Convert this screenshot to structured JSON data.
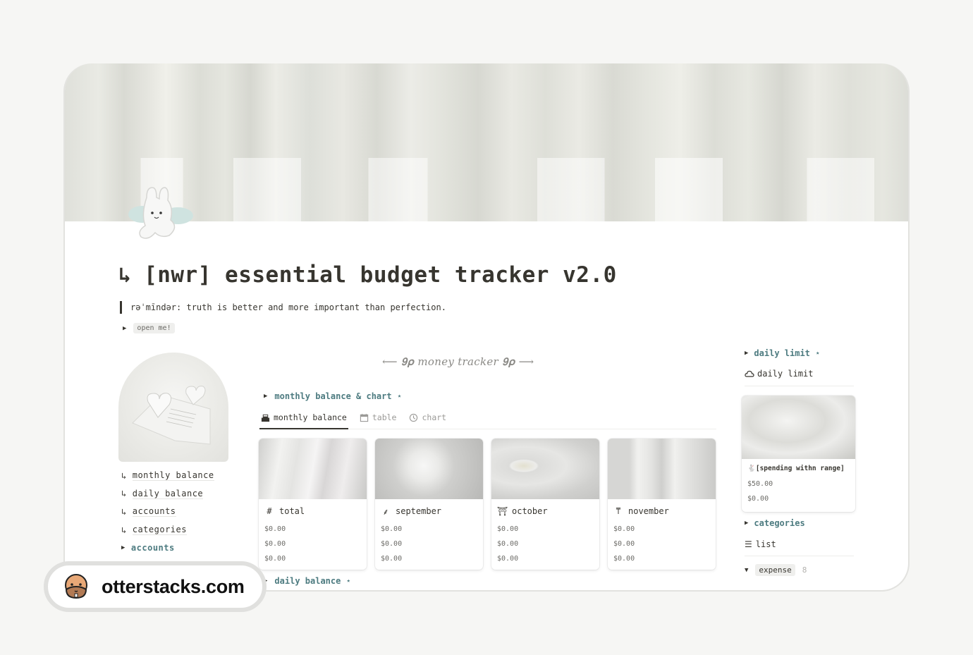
{
  "page": {
    "title_prefix_icon": "return-arrow-icon",
    "title": "[nwr] essential budget tracker v2.0",
    "quote": "rəˈmīndər: truth is better and more important than perfection.",
    "open_toggle": {
      "label": "open me!"
    }
  },
  "left_nav": {
    "links": [
      {
        "arrow": "↳",
        "label": "monthly balance"
      },
      {
        "arrow": "↳",
        "label": "daily balance"
      },
      {
        "arrow": "↳",
        "label": "accounts"
      },
      {
        "arrow": "↳",
        "label": "categories"
      }
    ],
    "accounts_toggle": {
      "label": "accounts"
    }
  },
  "main": {
    "banner": "⟵ 𝟗𝛒 money tracker 𝟗𝛒 ⟶",
    "monthly_section": {
      "label": "monthly balance & chart ⋆"
    },
    "tabs": [
      {
        "label": "monthly balance",
        "icon": "cash-register-icon",
        "active": true
      },
      {
        "label": "table",
        "icon": "calendar-icon",
        "active": false
      },
      {
        "label": "chart",
        "icon": "clock-chart-icon",
        "active": false
      }
    ],
    "cards": [
      {
        "title": "total",
        "icon": "#",
        "icon_name": "hash-icon",
        "values": [
          "$0.00",
          "$0.00",
          "$0.00"
        ]
      },
      {
        "title": "september",
        "icon": "⸙",
        "icon_name": "leaf-icon",
        "values": [
          "$0.00",
          "$0.00",
          "$0.00"
        ]
      },
      {
        "title": "october",
        "icon": "⛩",
        "icon_name": "torii-gate-icon",
        "values": [
          "$0.00",
          "$0.00",
          "$0.00"
        ]
      },
      {
        "title": "november",
        "icon": "⍑",
        "icon_name": "paint-roller-icon",
        "values": [
          "$0.00",
          "$0.00",
          "$0.00"
        ]
      }
    ],
    "daily_section": {
      "label": "daily balance ⋆"
    }
  },
  "right_col": {
    "daily_limit_toggle": {
      "label": "daily limit ⋆"
    },
    "daily_limit_view": {
      "label": "daily limit"
    },
    "limit_card": {
      "title": "[spending withn range]",
      "values": [
        "$50.00",
        "$0.00"
      ]
    },
    "categories_toggle": {
      "label": "categories"
    },
    "list_view": {
      "label": "list"
    },
    "group": {
      "label": "expense",
      "count": "8"
    }
  },
  "watermark": {
    "text": "otterstacks.com"
  },
  "colors": {
    "accent_teal": "#4d7b80",
    "text": "#37352f",
    "muted": "#9b9a97",
    "background": "#f6f6f4"
  }
}
